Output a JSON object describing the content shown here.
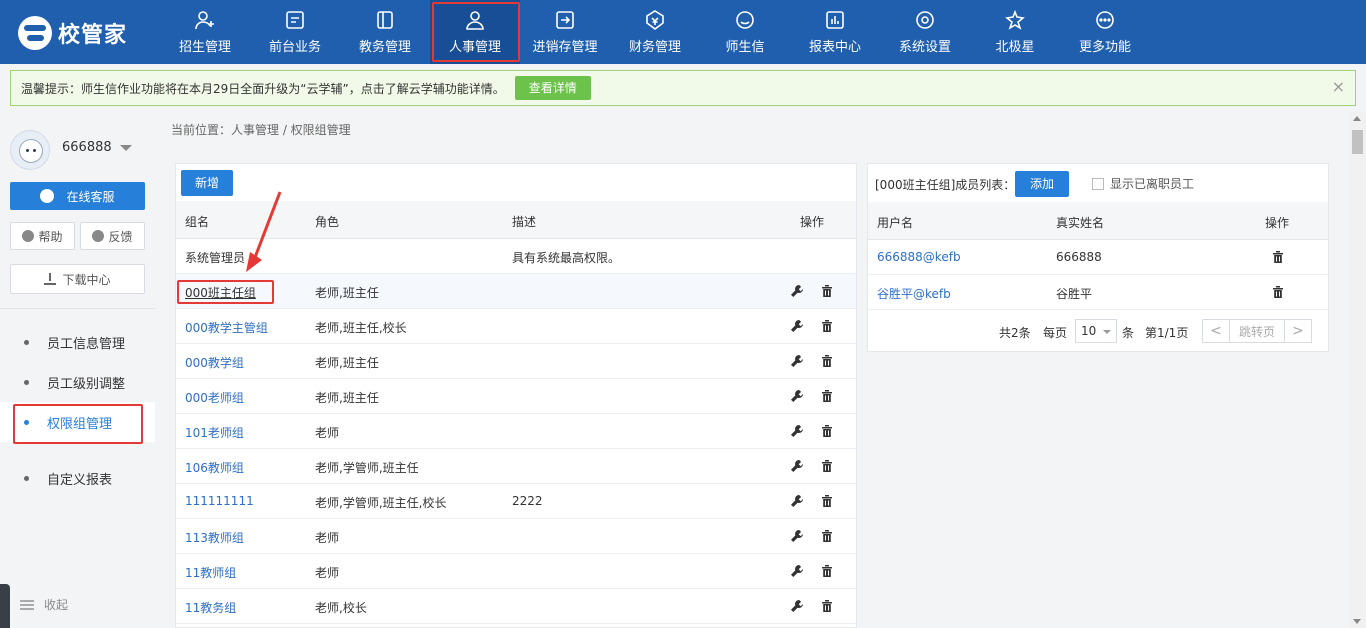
{
  "brand": {
    "name": "校管家"
  },
  "nav": [
    {
      "label": "招生管理",
      "icon": "person-add-icon"
    },
    {
      "label": "前台业务",
      "icon": "monitor-icon"
    },
    {
      "label": "教务管理",
      "icon": "book-icon"
    },
    {
      "label": "人事管理",
      "icon": "person-icon"
    },
    {
      "label": "进销存管理",
      "icon": "enter-box-icon"
    },
    {
      "label": "财务管理",
      "icon": "money-bag-icon"
    },
    {
      "label": "师生信",
      "icon": "chat-icon"
    },
    {
      "label": "报表中心",
      "icon": "bar-report-icon"
    },
    {
      "label": "系统设置",
      "icon": "gear-icon"
    },
    {
      "label": "北极星",
      "icon": "star-icon"
    },
    {
      "label": "更多功能",
      "icon": "more-icon"
    }
  ],
  "notice": {
    "text": "温馨提示：师生信作业功能将在本月29日全面升级为“云学辅”，点击了解云学辅功能详情。",
    "button": "查看详情",
    "close": "×"
  },
  "sidebar": {
    "username": "666888",
    "service": "在线客服",
    "help": "帮助",
    "feedback": "反馈",
    "download": "下载中心",
    "menu": [
      "员工信息管理",
      "员工级别调整",
      "权限组管理",
      "自定义报表"
    ],
    "collapse": "收起"
  },
  "breadcrumb": "当前位置：人事管理 / 权限组管理",
  "groups": {
    "add_label": "新增",
    "headers": {
      "name": "组名",
      "role": "角色",
      "desc": "描述",
      "action": "操作"
    },
    "rows": [
      {
        "name": "系统管理员",
        "role": "",
        "desc": "具有系统最高权限。"
      },
      {
        "name": "000班主任组",
        "role": "老师,班主任",
        "desc": ""
      },
      {
        "name": "000教学主管组",
        "role": "老师,班主任,校长",
        "desc": ""
      },
      {
        "name": "000教学组",
        "role": "老师,班主任",
        "desc": ""
      },
      {
        "name": "000老师组",
        "role": "老师,班主任",
        "desc": ""
      },
      {
        "name": "101老师组",
        "role": "老师",
        "desc": ""
      },
      {
        "name": "106教师组",
        "role": "老师,学管师,班主任",
        "desc": ""
      },
      {
        "name": "111111111",
        "role": "老师,学管师,班主任,校长",
        "desc": "2222"
      },
      {
        "name": "113教师组",
        "role": "老师",
        "desc": ""
      },
      {
        "name": "11教师组",
        "role": "老师",
        "desc": ""
      },
      {
        "name": "11教务组",
        "role": "老师,校长",
        "desc": ""
      }
    ]
  },
  "members": {
    "title": "[000班主任组]成员列表：",
    "add_label": "添加",
    "show_resigned": "显示已离职员工",
    "headers": {
      "user": "用户名",
      "real_name": "真实姓名",
      "action": "操作"
    },
    "rows": [
      {
        "user": "666888@kefb",
        "real_name": "666888"
      },
      {
        "user": "谷胜平@kefb",
        "real_name": "谷胜平"
      }
    ],
    "pager": {
      "total": "共2条",
      "per_page_label": "每页",
      "per_page": "10",
      "unit": "条",
      "page": "第1/1页",
      "prev": "<",
      "jump": "跳转页",
      "next": ">"
    }
  },
  "colors": {
    "nav_bg": "#1f5fae",
    "accent": "#2680d9",
    "highlight": "#e53935",
    "notice_btn": "#6cc24a"
  }
}
